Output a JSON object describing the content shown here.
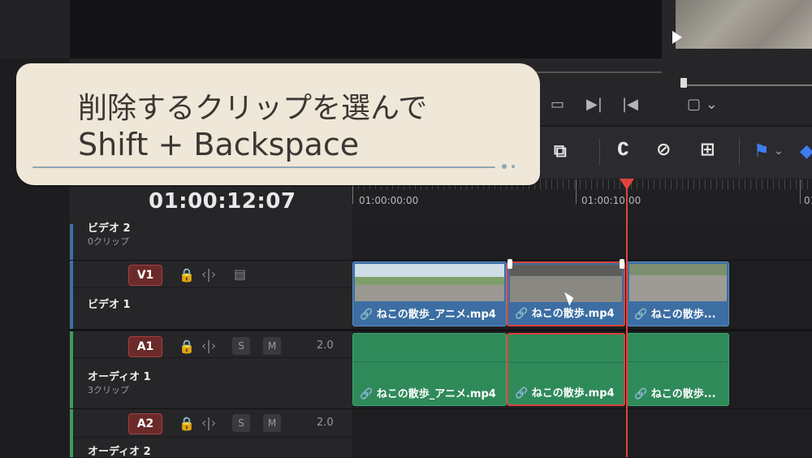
{
  "callout": {
    "line1": "削除するクリップを選んで",
    "line2": "Shift + Backspace"
  },
  "timeline": {
    "timecode": "01:00:12:07",
    "ruler_labels": [
      "01:00:00:00",
      "01:00:10:00",
      "01"
    ]
  },
  "tracks": {
    "v2": {
      "name": "ビデオ 2",
      "sub": "0クリップ"
    },
    "v1": {
      "badge": "V1",
      "name": "ビデオ 1"
    },
    "a1": {
      "badge": "A1",
      "name": "オーディオ 1",
      "sub": "3クリップ",
      "solo": "S",
      "mute": "M",
      "level": "2.0"
    },
    "a2": {
      "badge": "A2",
      "name": "オーディオ 2",
      "solo": "S",
      "mute": "M",
      "level": "2.0"
    }
  },
  "clips": {
    "video": [
      {
        "label": "ねこの散歩_アニメ.mp4"
      },
      {
        "label": "ねこの散歩.mp4",
        "selected": true
      },
      {
        "label": "ねこの散歩..."
      }
    ],
    "audio": [
      {
        "label": "ねこの散歩_アニメ.mp4"
      },
      {
        "label": "ねこの散歩.mp4",
        "selected": true
      },
      {
        "label": "ねこの散歩..."
      }
    ]
  },
  "icons": {
    "link": "🔗",
    "lock": "🔒",
    "film": "🎞",
    "transform": "‹|›"
  },
  "colors": {
    "playhead": "#e0443d",
    "video_clip": "#3c6ea3",
    "audio_clip": "#2f8a5a",
    "selection": "#d9443d",
    "callout_bg": "#efe7d8"
  }
}
